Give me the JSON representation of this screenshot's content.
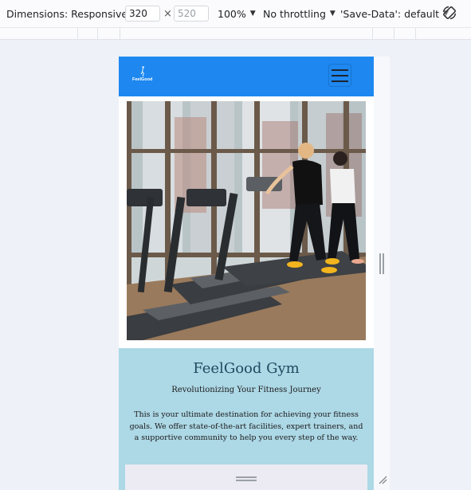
{
  "devtools": {
    "dimensions_label": "Dimensions: Responsive",
    "width_value": "320",
    "height_value": "520",
    "times": "×",
    "zoom": "100%",
    "throttle": "No throttling",
    "save_data": "'Save-Data': default"
  },
  "site": {
    "logo_text": "FeelGood",
    "title": "FeelGood Gym",
    "tagline": "Revolutionizing Your Fitness Journey",
    "description": "This is your ultimate destination for achieving your fitness goals. We offer state-of-the-art facilities, expert trainers, and a supportive community to help you every step of the way."
  },
  "colors": {
    "navbar": "#1e88f0",
    "info_bg": "#add8e6",
    "title": "#1f4a60"
  }
}
